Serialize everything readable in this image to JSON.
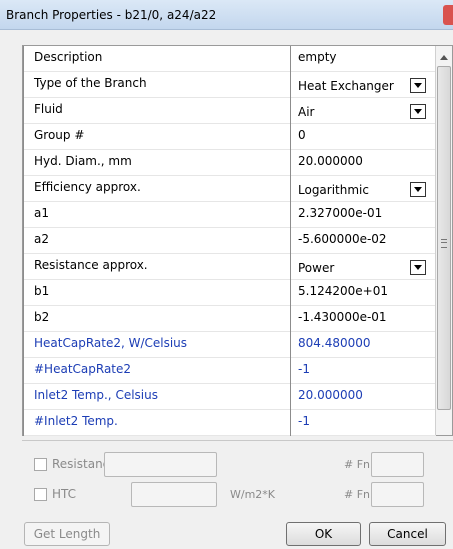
{
  "window": {
    "title": "Branch Properties - b21/0, a24/a22"
  },
  "properties": [
    {
      "key": "Description",
      "value": "empty",
      "combo": false,
      "blue": false
    },
    {
      "key": "Type of the Branch",
      "value": "Heat Exchanger",
      "combo": true,
      "blue": false
    },
    {
      "key": "Fluid",
      "value": "Air",
      "combo": true,
      "blue": false
    },
    {
      "key": "Group #",
      "value": "0",
      "combo": false,
      "blue": false
    },
    {
      "key": "Hyd. Diam., mm",
      "value": "20.000000",
      "combo": false,
      "blue": false
    },
    {
      "key": "Efficiency approx.",
      "value": "Logarithmic",
      "combo": true,
      "blue": false
    },
    {
      "key": "a1",
      "value": "2.327000e-01",
      "combo": false,
      "blue": false
    },
    {
      "key": "a2",
      "value": "-5.600000e-02",
      "combo": false,
      "blue": false
    },
    {
      "key": "Resistance approx.",
      "value": "Power",
      "combo": true,
      "blue": false
    },
    {
      "key": "b1",
      "value": "5.124200e+01",
      "combo": false,
      "blue": false
    },
    {
      "key": "b2",
      "value": "-1.430000e-01",
      "combo": false,
      "blue": false
    },
    {
      "key": "HeatCapRate2, W/Celsius",
      "value": "804.480000",
      "combo": false,
      "blue": true
    },
    {
      "key": "#HeatCapRate2",
      "value": "-1",
      "combo": false,
      "blue": true
    },
    {
      "key": "Inlet2 Temp., Celsius",
      "value": "20.000000",
      "combo": false,
      "blue": true
    },
    {
      "key": "#Inlet2 Temp.",
      "value": "-1",
      "combo": false,
      "blue": true
    }
  ],
  "options": {
    "resistance": {
      "label": "Resistance",
      "fn_label": "# Fn"
    },
    "htc": {
      "label": "HTC",
      "unit": "W/m2*K",
      "fn_label": "# Fn"
    }
  },
  "buttons": {
    "get_length": "Get Length",
    "ok": "OK",
    "cancel": "Cancel"
  },
  "colors": {
    "blue_rows": "#1c3db5",
    "close_button": "#d9534f"
  }
}
